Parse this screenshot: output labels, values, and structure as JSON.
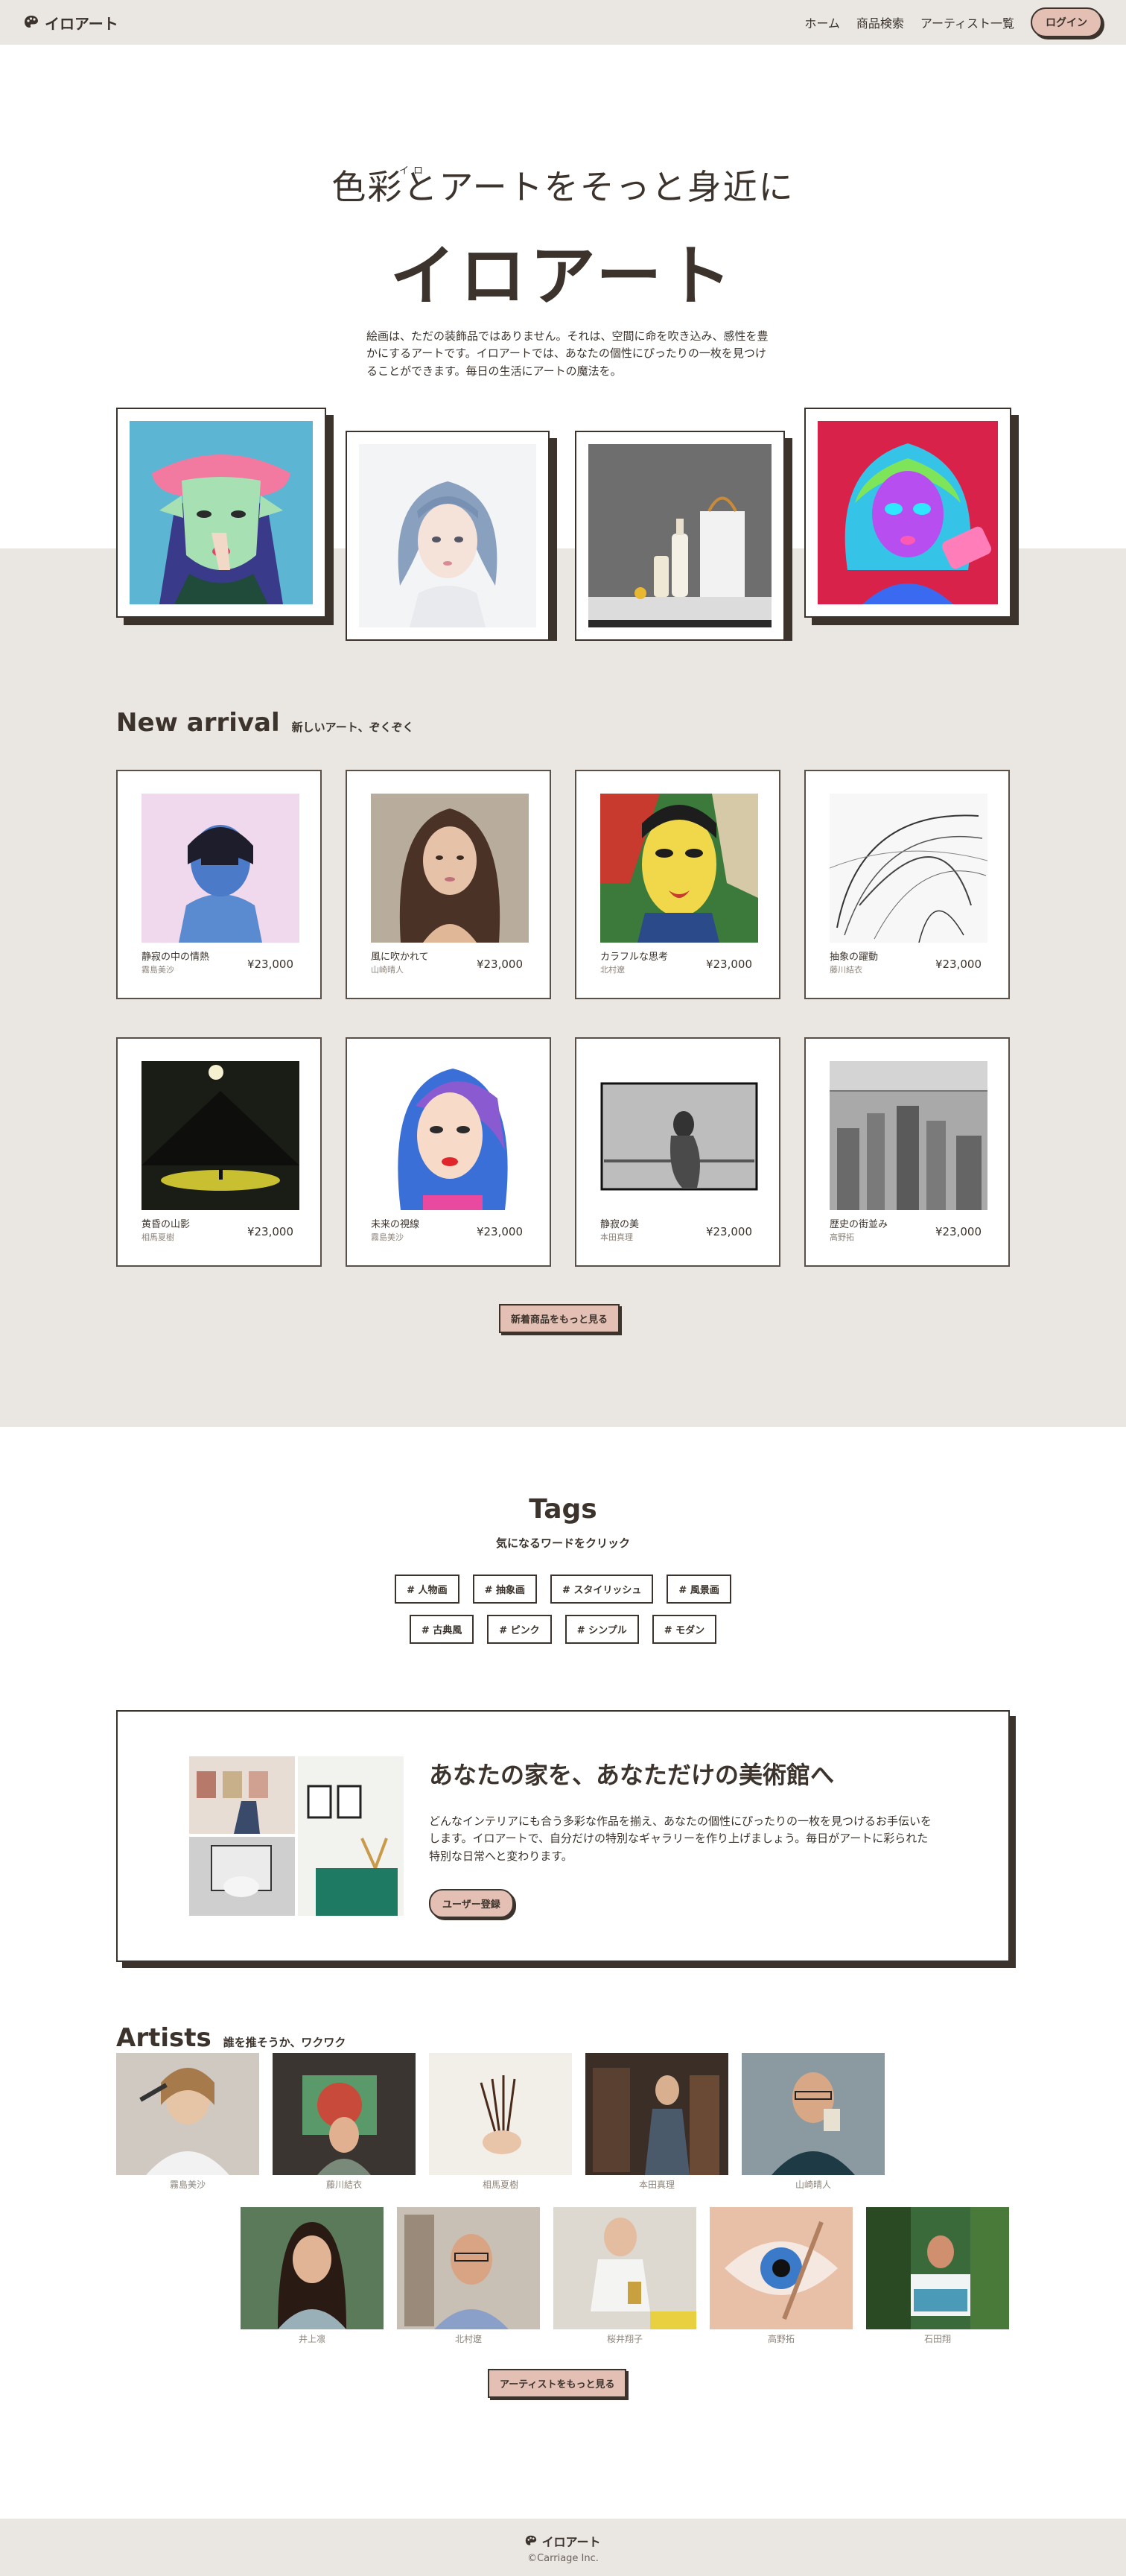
{
  "header": {
    "logo_text": "イロアート",
    "nav": [
      "ホーム",
      "商品検索",
      "アーティスト一覧"
    ],
    "login_label": "ログイン"
  },
  "hero": {
    "tagline": "色彩とアートをそっと身近に",
    "ruby": "イロ",
    "title": "イロアート",
    "description": "絵画は、ただの装飾品ではありません。それは、空間に命を吹き込み、感性を豊かにするアートです。イロアートでは、あなたの個性にぴったりの一枚を見つけることができます。毎日の生活にアートの魔法を。"
  },
  "new_arrival": {
    "title": "New arrival",
    "subtitle": "新しいアート、ぞくぞく",
    "items": [
      {
        "name": "静寂の中の情熱",
        "artist": "霧島美沙",
        "price": "¥23,000"
      },
      {
        "name": "風に吹かれて",
        "artist": "山崎晴人",
        "price": "¥23,000"
      },
      {
        "name": "カラフルな思考",
        "artist": "北村遼",
        "price": "¥23,000"
      },
      {
        "name": "抽象の躍動",
        "artist": "藤川結衣",
        "price": "¥23,000"
      },
      {
        "name": "黄昏の山影",
        "artist": "相馬夏樹",
        "price": "¥23,000"
      },
      {
        "name": "未来の視線",
        "artist": "霧島美沙",
        "price": "¥23,000"
      },
      {
        "name": "静寂の美",
        "artist": "本田真理",
        "price": "¥23,000"
      },
      {
        "name": "歴史の街並み",
        "artist": "高野拓",
        "price": "¥23,000"
      }
    ],
    "more_label": "新着商品をもっと見る"
  },
  "tags": {
    "title": "Tags",
    "subtitle": "気になるワードをクリック",
    "row1": [
      "# 人物画",
      "# 抽象画",
      "# スタイリッシュ",
      "# 風景画"
    ],
    "row2": [
      "# 古典風",
      "# ピンク",
      "# シンプル",
      "# モダン"
    ]
  },
  "promo": {
    "title": "あなたの家を、あなただけの美術館へ",
    "text": "どんなインテリアにも合う多彩な作品を揃え、あなたの個性にぴったりの一枚を見つけるお手伝いをします。イロアートで、自分だけの特別なギャラリーを作り上げましょう。毎日がアートに彩られた特別な日常へと変わります。",
    "button_label": "ユーザー登録"
  },
  "artists": {
    "title": "Artists",
    "subtitle": "誰を推そうか、ワクワク",
    "items": [
      "霧島美沙",
      "藤川結衣",
      "相馬夏樹",
      "本田真理",
      "山崎晴人",
      "井上凛",
      "北村遼",
      "桜井翔子",
      "高野拓",
      "石田翔"
    ],
    "more_label": "アーティストをもっと見る"
  },
  "footer": {
    "logo_text": "イロアート",
    "copyright": "©Carriage Inc."
  }
}
